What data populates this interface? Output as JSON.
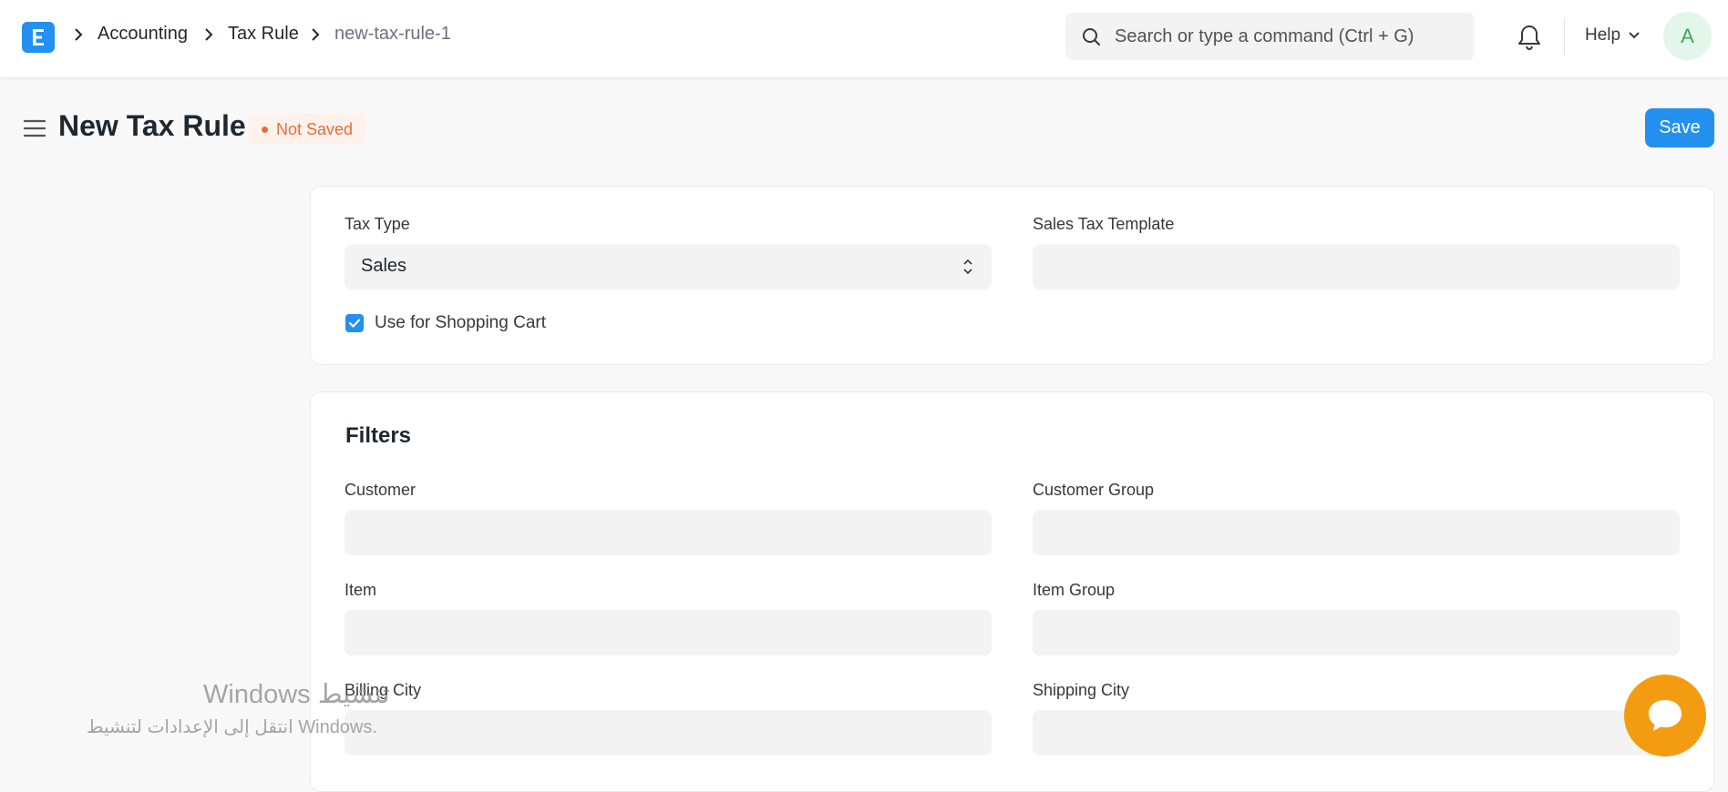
{
  "navbar": {
    "logo_letter": "E",
    "breadcrumbs": [
      {
        "label": "Accounting"
      },
      {
        "label": "Tax Rule"
      },
      {
        "label": "new-tax-rule-1"
      }
    ],
    "search": {
      "placeholder": "Search or type a command (Ctrl + G)",
      "value": ""
    },
    "help_label": "Help",
    "avatar_initial": "A"
  },
  "page": {
    "title": "New Tax Rule",
    "status": "Not Saved",
    "save_label": "Save"
  },
  "form": {
    "tax_type": {
      "label": "Tax Type",
      "value": "Sales"
    },
    "sales_tax_template": {
      "label": "Sales Tax Template",
      "value": ""
    },
    "use_for_shopping_cart": {
      "label": "Use for Shopping Cart",
      "checked": true
    }
  },
  "filters": {
    "title": "Filters",
    "customer": {
      "label": "Customer",
      "value": ""
    },
    "customer_group": {
      "label": "Customer Group",
      "value": ""
    },
    "item": {
      "label": "Item",
      "value": ""
    },
    "item_group": {
      "label": "Item Group",
      "value": ""
    },
    "billing_city": {
      "label": "Billing City",
      "value": ""
    },
    "shipping_city": {
      "label": "Shipping City",
      "value": ""
    }
  },
  "watermark": {
    "line1": "تنشيط Windows",
    "line2": "انتقل إلى الإعدادات لتنشيط Windows."
  },
  "colors": {
    "primary": "#2490ef",
    "status": "#e86c3a",
    "chat": "#f39c12",
    "avatar_bg": "#e4f5e9",
    "avatar_fg": "#3da557"
  },
  "icons": {
    "menu": "hamburger-icon",
    "search": "search-icon",
    "bell": "bell-icon",
    "help_chevron": "chevron-down-icon",
    "chat": "chat-bubble-icon"
  }
}
